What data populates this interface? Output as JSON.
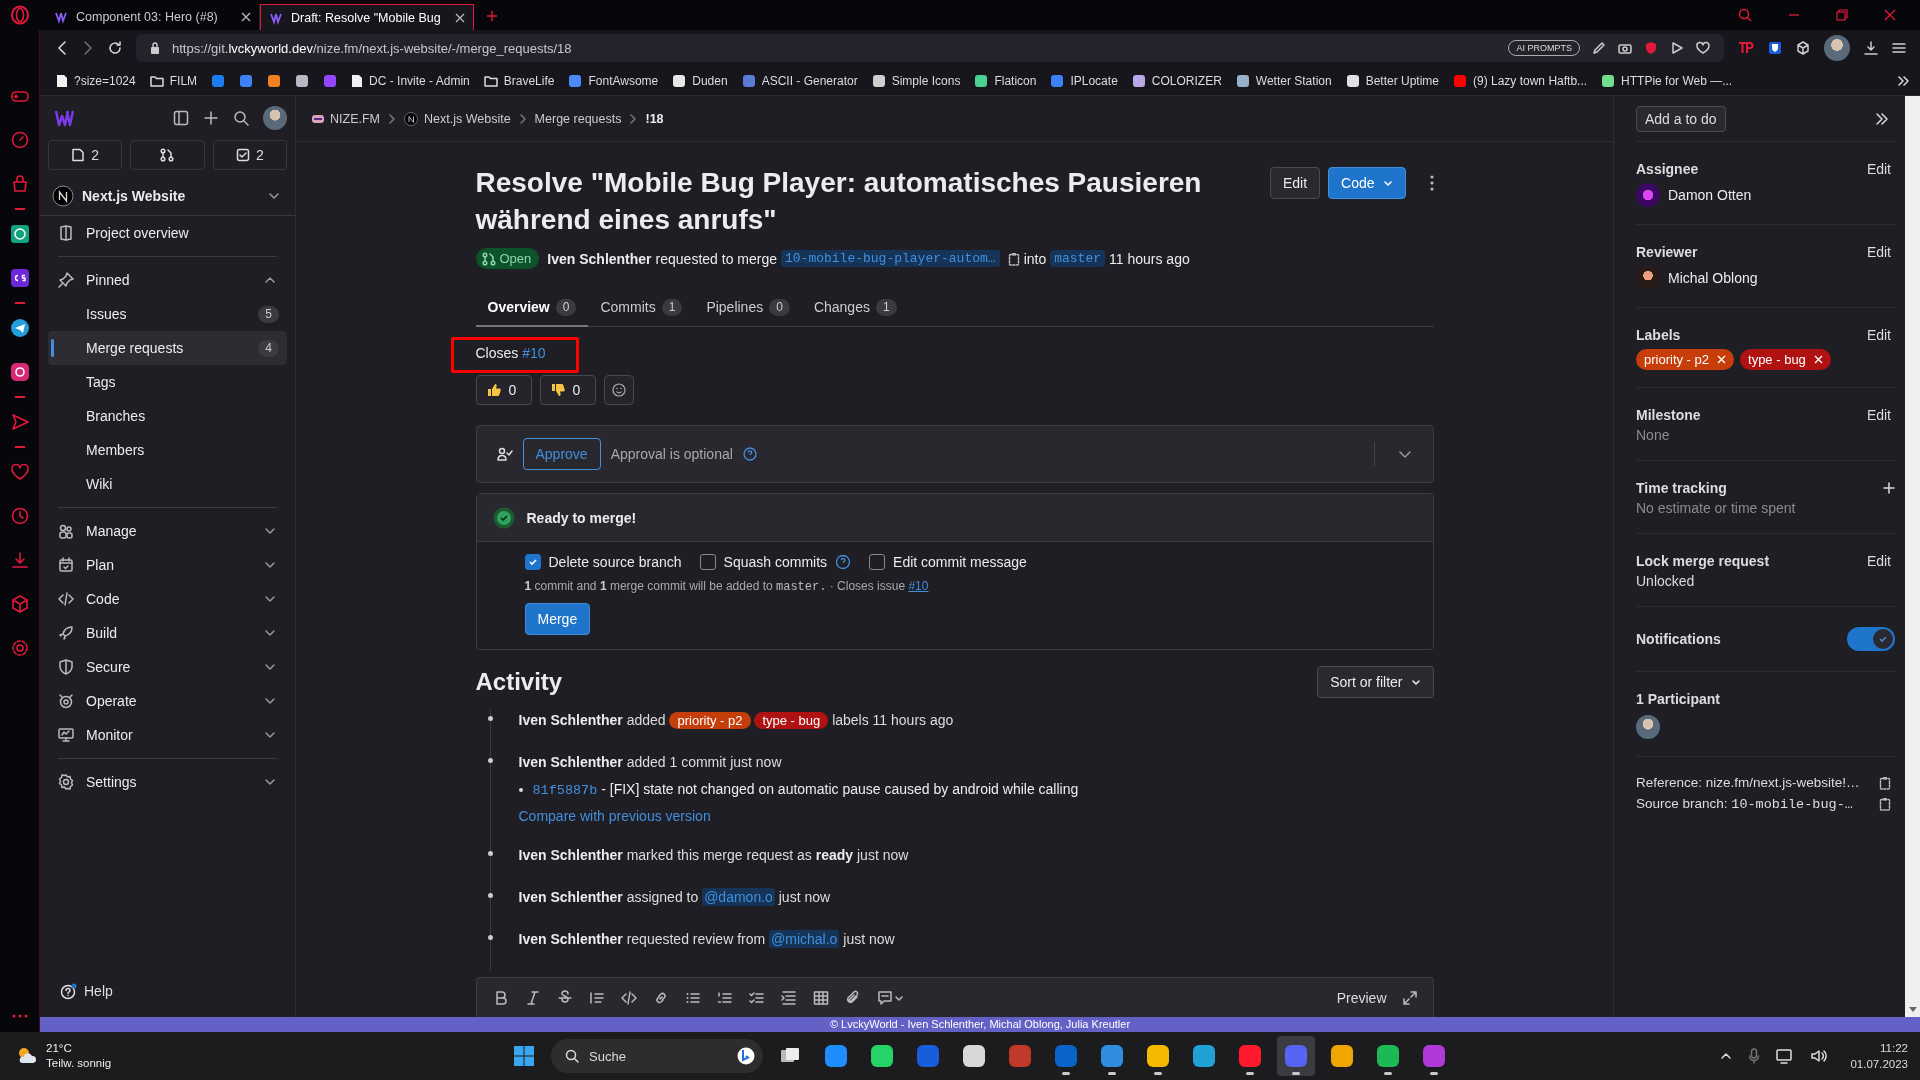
{
  "browser": {
    "tabs": [
      {
        "title": "Component 03: Hero (#8)",
        "selected": false
      },
      {
        "title": "Draft: Resolve \"Mobile Bug",
        "selected": true
      }
    ],
    "url": "https://git.**lvckyworld.dev**/nize.fm/next.js-website/-/merge_requests/18",
    "ai_badge": "AI PROMPTS",
    "bookmarks": [
      {
        "kind": "page",
        "label": "?size=1024"
      },
      {
        "kind": "folder",
        "label": "FILM"
      },
      {
        "kind": "site",
        "color": "#1e7bf0"
      },
      {
        "kind": "site",
        "color": "#3b82f6"
      },
      {
        "kind": "site",
        "color": "#f38020"
      },
      {
        "kind": "site",
        "color": "#b8b8c4"
      },
      {
        "kind": "site",
        "color": "#9146ff"
      },
      {
        "kind": "page",
        "label": "DC - Invite - Admin"
      },
      {
        "kind": "folder",
        "label": "BraveLife"
      },
      {
        "kind": "site",
        "color": "#4c8bf5",
        "label": "FontAwsome"
      },
      {
        "kind": "site",
        "color": "#e6e6e6",
        "label": "Duden"
      },
      {
        "kind": "site",
        "color": "#5a7bd8",
        "label": "ASCII - Generator"
      },
      {
        "kind": "site",
        "color": "#cfcfcf",
        "label": "Simple Icons"
      },
      {
        "kind": "site",
        "color": "#4ad295",
        "label": "Flaticon"
      },
      {
        "kind": "site",
        "color": "#3b82f6",
        "label": "IPLocate"
      },
      {
        "kind": "site",
        "color": "#b9a7e8",
        "label": "COLORIZER"
      },
      {
        "kind": "site",
        "color": "#9ab0c8",
        "label": "Wetter Station"
      },
      {
        "kind": "site",
        "color": "#e0e0e0",
        "label": "Better Uptime"
      },
      {
        "kind": "site",
        "color": "#ff0000",
        "label": "(9) Lazy town Haftb..."
      },
      {
        "kind": "site",
        "color": "#73dc8c",
        "label": "HTTPie for Web —..."
      }
    ]
  },
  "sidebar": {
    "counters": [
      {
        "kind": "issues",
        "count": "2"
      },
      {
        "kind": "merge-requests"
      },
      {
        "kind": "todos",
        "count": "2"
      }
    ],
    "project": "Next.js Website",
    "groups": [
      {
        "items": [
          {
            "kind": "link",
            "label": "Project overview"
          }
        ]
      },
      {
        "items": [
          {
            "kind": "section",
            "label": "Pinned",
            "expanded": true,
            "children": [
              {
                "label": "Issues",
                "count": "5",
                "selected": false
              },
              {
                "label": "Merge requests",
                "count": "4",
                "selected": true
              },
              {
                "label": "Tags",
                "selected": false
              },
              {
                "label": "Branches",
                "selected": false
              },
              {
                "label": "Members",
                "selected": false
              },
              {
                "label": "Wiki",
                "selected": false
              }
            ]
          }
        ]
      },
      {
        "items": [
          {
            "kind": "section",
            "label": "Manage",
            "expanded": false
          },
          {
            "kind": "section",
            "label": "Plan",
            "expanded": false
          },
          {
            "kind": "section",
            "label": "Code",
            "expanded": false
          },
          {
            "kind": "section",
            "label": "Build",
            "expanded": false
          },
          {
            "kind": "section",
            "label": "Secure",
            "expanded": false
          },
          {
            "kind": "section",
            "label": "Operate",
            "expanded": false
          },
          {
            "kind": "section",
            "label": "Monitor",
            "expanded": false
          }
        ]
      },
      {
        "items": [
          {
            "kind": "section",
            "label": "Settings",
            "expanded": false
          }
        ]
      }
    ],
    "help": "Help"
  },
  "breadcrumbs": [
    {
      "kind": "group",
      "label": "NIZE.FM"
    },
    {
      "kind": "project",
      "label": "Next.js Website"
    },
    {
      "kind": "plain",
      "label": "Merge requests"
    },
    {
      "kind": "current",
      "label": "!18"
    }
  ],
  "merge_request": {
    "title": "Resolve \"Mobile Bug Player: automatisches Pausieren während eines anrufs\"",
    "status": "Open",
    "author": "Iven Schlenther",
    "action": "requested to merge",
    "source_branch": "10-mobile-bug-player-autom…",
    "into": "into",
    "target_branch": "master",
    "time": "11 hours ago",
    "buttons": [
      {
        "kind": "default",
        "label": "Edit"
      },
      {
        "kind": "primary",
        "label": "Code"
      }
    ]
  },
  "tabs": [
    {
      "label": "Overview",
      "count": "0",
      "selected": true
    },
    {
      "label": "Commits",
      "count": "1",
      "selected": false
    },
    {
      "label": "Pipelines",
      "count": "0",
      "selected": false
    },
    {
      "label": "Changes",
      "count": "1",
      "selected": false
    }
  ],
  "description": {
    "text": "Closes",
    "link": "#10",
    "highlighted": true
  },
  "reactions": [
    {
      "kind": "thumbs-up",
      "count": "0"
    },
    {
      "kind": "thumbs-down",
      "count": "0"
    }
  ],
  "approval": {
    "button": "Approve",
    "text": "Approval is optional"
  },
  "merge": {
    "title": "Ready to merge!",
    "options": [
      {
        "label": "Delete source branch",
        "checked": true
      },
      {
        "label": "Squash commits",
        "checked": false,
        "help": true
      },
      {
        "label": "Edit commit message",
        "checked": false
      }
    ],
    "info": "**1** commit and **1** merge commit will be added to",
    "info_branch": "master.",
    "info_after": "· Closes issue",
    "info_link": "#10",
    "button": "Merge"
  },
  "activity": {
    "title": "Activity",
    "sort": "Sort or filter",
    "items": [
      {
        "kind": "labels",
        "author": "Iven Schlenther",
        "before": "added",
        "labels": [
          {
            "name": "priority - p2",
            "color": "#c73d0a"
          },
          {
            "name": "type - bug",
            "color": "#b01212"
          }
        ],
        "after": "labels 11 hours ago"
      },
      {
        "kind": "commits",
        "author": "Iven Schlenther",
        "before": "added 1 commit just now",
        "commits": [
          {
            "sha": "81f5887b",
            "message": "- [FIX] state not changed on automatic pause caused by android while calling"
          }
        ],
        "compare": "Compare with previous version"
      },
      {
        "kind": "text",
        "author": "Iven Schlenther",
        "before": "marked this merge request as **ready** just now"
      },
      {
        "kind": "mention",
        "author": "Iven Schlenther",
        "before": "assigned to",
        "mention": "@damon.o",
        "after": "just now"
      },
      {
        "kind": "mention",
        "author": "Iven Schlenther",
        "before": "requested review from",
        "mention": "@michal.o",
        "after": "just now"
      }
    ],
    "preview": "Preview"
  },
  "right": {
    "todo": "Add a to do",
    "sections": [
      {
        "kind": "person",
        "title": "Assignee",
        "action": "Edit",
        "name": "Damon Otten"
      },
      {
        "kind": "person",
        "title": "Reviewer",
        "action": "Edit",
        "name": "Michal Oblong"
      },
      {
        "kind": "labels",
        "title": "Labels",
        "action": "Edit",
        "labels": [
          {
            "name": "priority - p2",
            "color": "#c73d0a"
          },
          {
            "name": "type - bug",
            "color": "#b01212"
          }
        ]
      },
      {
        "kind": "value",
        "title": "Milestone",
        "action": "Edit",
        "value": "None",
        "muted": true
      },
      {
        "kind": "add",
        "title": "Time tracking",
        "value": "No estimate or time spent",
        "muted": true
      },
      {
        "kind": "value",
        "title": "Lock merge request",
        "action": "Edit",
        "value": "Unlocked",
        "muted": false
      },
      {
        "kind": "toggle",
        "title": "Notifications",
        "on": true
      },
      {
        "kind": "participants",
        "title": "1 Participant"
      },
      {
        "kind": "refs",
        "rows": [
          {
            "label": "Reference:",
            "value": "nize.fm/next.js-website!…"
          },
          {
            "label": "Source branch:",
            "value": "10-mobile-bug-…",
            "mono": true
          }
        ]
      }
    ]
  },
  "footer": "© LvckyWorld - Iven Schlenther, Michal Oblong, Julia Kreutler",
  "taskbar": {
    "temp": "21°C",
    "weather": "Teilw. sonnig",
    "search": "Suche",
    "apps": [
      {
        "kind": "start"
      },
      {
        "kind": "search"
      },
      {
        "kind": "taskview"
      },
      {
        "kind": "app",
        "color": "#1f8cff",
        "running": false,
        "selected": false
      },
      {
        "kind": "app",
        "color": "#25d366",
        "running": false,
        "selected": false
      },
      {
        "kind": "app",
        "color": "#175ddc",
        "running": false,
        "selected": false
      },
      {
        "kind": "app",
        "color": "#d8d8d8",
        "running": false,
        "selected": false
      },
      {
        "kind": "app",
        "color": "#c0392b",
        "running": false,
        "selected": false
      },
      {
        "kind": "app",
        "color": "#0a64c8",
        "running": true,
        "selected": false
      },
      {
        "kind": "app",
        "color": "#2f8ee0",
        "running": true,
        "selected": false
      },
      {
        "kind": "app",
        "color": "#f5b800",
        "running": true,
        "selected": false
      },
      {
        "kind": "app",
        "color": "#1fa1d8",
        "running": false,
        "selected": false
      },
      {
        "kind": "app",
        "color": "#ff1b2d",
        "running": true,
        "selected": false
      },
      {
        "kind": "app",
        "color": "#5865f2",
        "running": true,
        "selected": true
      },
      {
        "kind": "app",
        "color": "#f0a500",
        "running": false,
        "selected": false
      },
      {
        "kind": "app",
        "color": "#1db954",
        "running": true,
        "selected": false
      },
      {
        "kind": "app",
        "color": "#b03ad8",
        "running": true,
        "selected": false
      }
    ],
    "time": "11:22",
    "date": "01.07.2023"
  }
}
